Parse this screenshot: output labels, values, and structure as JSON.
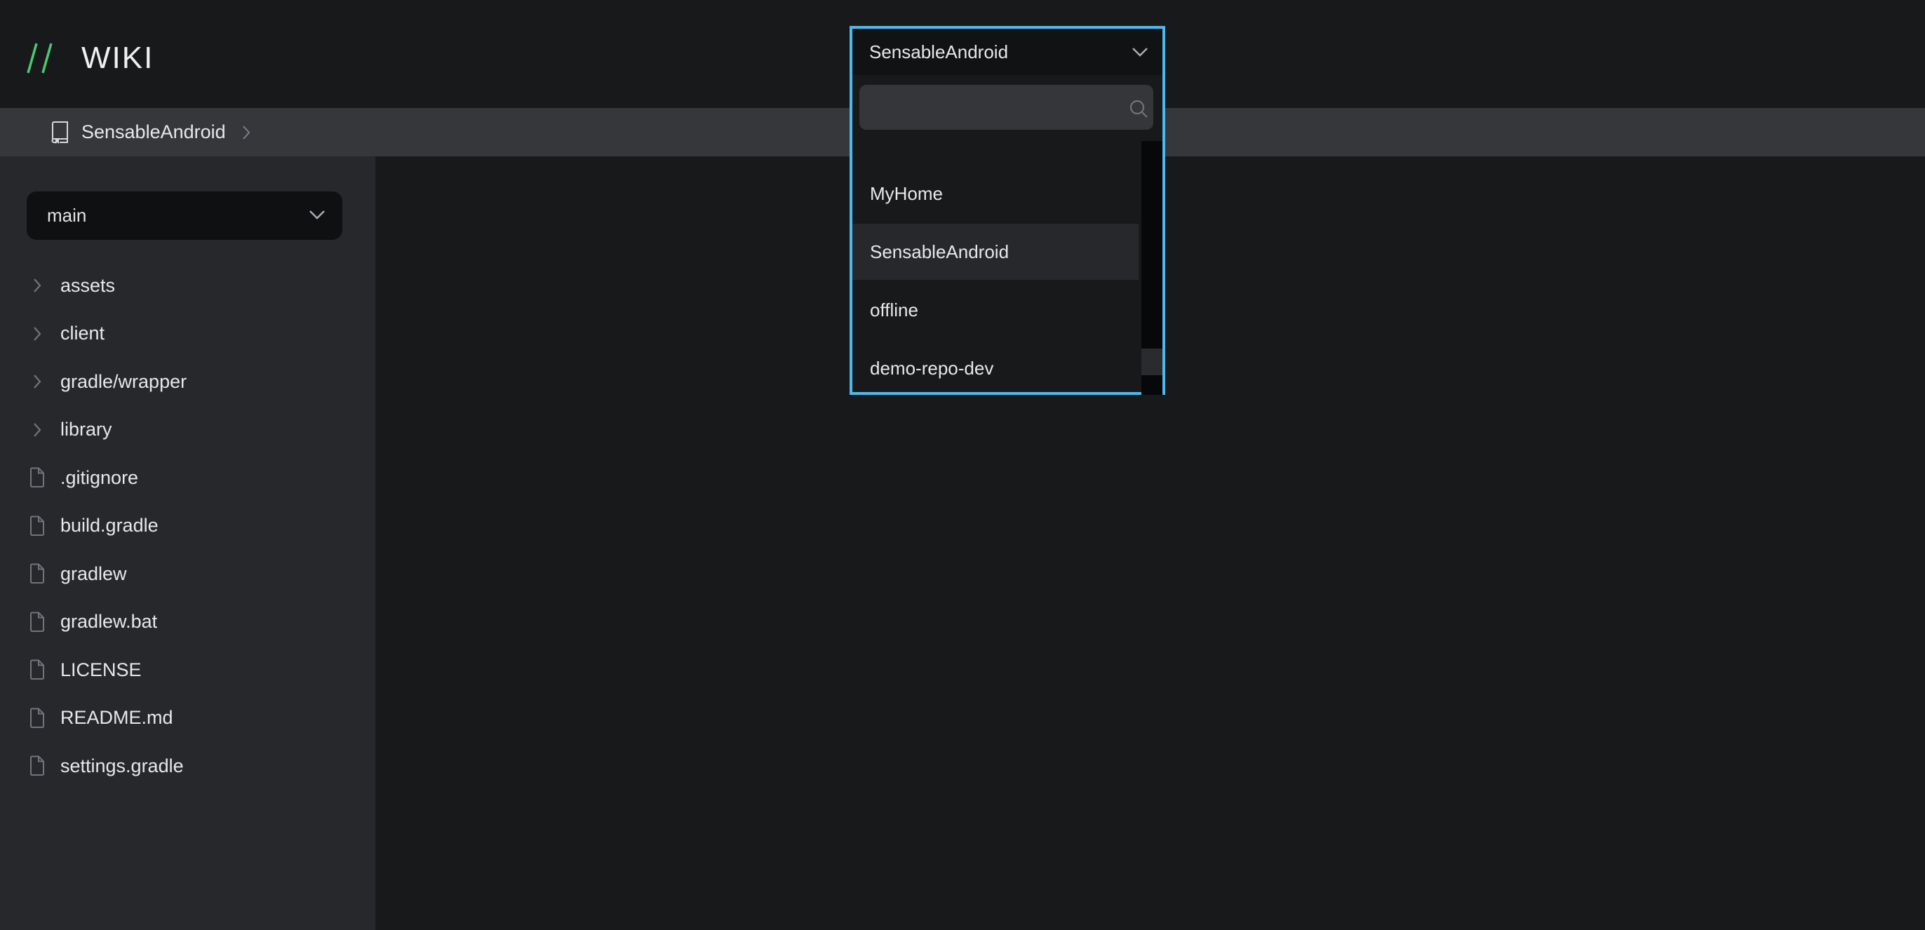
{
  "header": {
    "logo_mark": "//",
    "title": "WIKI",
    "logo_color": "#4cc970"
  },
  "breadcrumb": {
    "icon": "repo-book-icon",
    "items": [
      {
        "label": "SensableAndroid"
      }
    ],
    "separator_icon": "chevron-right-icon"
  },
  "sidebar": {
    "branch_select": {
      "value": "main",
      "icon": "chevron-down-icon"
    },
    "tree": [
      {
        "type": "folder",
        "label": "assets",
        "icon": "chevron-right-icon"
      },
      {
        "type": "folder",
        "label": "client",
        "icon": "chevron-right-icon"
      },
      {
        "type": "folder",
        "label": "gradle/wrapper",
        "icon": "chevron-right-icon"
      },
      {
        "type": "folder",
        "label": "library",
        "icon": "chevron-right-icon"
      },
      {
        "type": "file",
        "label": ".gitignore",
        "icon": "file-icon"
      },
      {
        "type": "file",
        "label": "build.gradle",
        "icon": "file-icon"
      },
      {
        "type": "file",
        "label": "gradlew",
        "icon": "file-icon"
      },
      {
        "type": "file",
        "label": "gradlew.bat",
        "icon": "file-icon"
      },
      {
        "type": "file",
        "label": "LICENSE",
        "icon": "file-icon"
      },
      {
        "type": "file",
        "label": "README.md",
        "icon": "file-icon"
      },
      {
        "type": "file",
        "label": "settings.gradle",
        "icon": "file-icon"
      }
    ]
  },
  "repo_dropdown": {
    "selected": "SensableAndroid",
    "search": {
      "value": "",
      "placeholder": "",
      "icon": "search-icon"
    },
    "options": [
      {
        "label": "MyHome",
        "selected": false
      },
      {
        "label": "SensableAndroid",
        "selected": true
      },
      {
        "label": "offline",
        "selected": false
      },
      {
        "label": "demo-repo-dev",
        "selected": false
      }
    ],
    "scroll_position": 0.95,
    "focus_color": "#4fb8ec"
  }
}
